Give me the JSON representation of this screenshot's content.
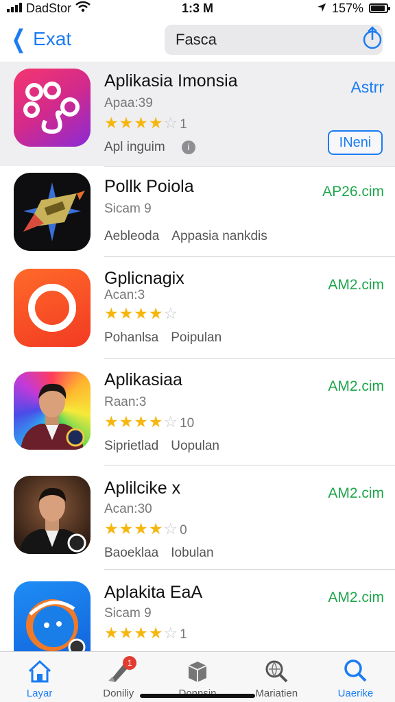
{
  "status_bar": {
    "carrier": "DadStor",
    "time": "1:3 M",
    "battery": "157%",
    "battery_level": 0.9
  },
  "nav": {
    "back_label": "Exat",
    "search_text": "Fasca"
  },
  "apps": [
    {
      "name": "Aplikasia Imonsia",
      "subtitle": "Apaa:39",
      "rating_count": "1",
      "tags": [
        "Apl inguim"
      ],
      "action_label": "Astrr",
      "secondary_label": "INeni"
    },
    {
      "name": "Pollk Poiola",
      "subtitle": "Sicam 9",
      "tags": [
        "Aebleoda",
        "Appasia nankdis"
      ],
      "action_label": "AP26.cim"
    },
    {
      "name": "Gplicnagix",
      "subtitle": "Acan:3",
      "rating_count": "",
      "tags": [
        "Pohanlsa",
        "Poipulan"
      ],
      "action_label": "AM2.cim"
    },
    {
      "name": "Aplikasiaa",
      "subtitle": "Raan:3",
      "rating_count": "10",
      "tags": [
        "Siprietlad",
        "Uopulan"
      ],
      "action_label": "AM2.cim"
    },
    {
      "name": "Aplilcike x",
      "subtitle": "Acan:30",
      "rating_count": "0",
      "tags": [
        "Baoeklaa",
        "Iobulan"
      ],
      "action_label": "AM2.cim"
    },
    {
      "name": "Aplakita EaA",
      "subtitle": "Sicam 9",
      "rating_count": "1",
      "tags": [],
      "action_label": "AM2.cim"
    }
  ],
  "tabs": [
    {
      "label": "Layar",
      "icon": "house-icon",
      "active": true
    },
    {
      "label": "Doniliy",
      "icon": "brush-icon",
      "badge": "1"
    },
    {
      "label": "Donnsin",
      "icon": "box-icon"
    },
    {
      "label": "Mariatien",
      "icon": "magnifier-globe-icon"
    },
    {
      "label": "Uaerike",
      "icon": "search-icon",
      "active": true
    }
  ],
  "colors": {
    "accent": "#1a7cf3",
    "price_green": "#1ea64b",
    "star": "#f6b60e",
    "badge_red": "#e23b30"
  }
}
